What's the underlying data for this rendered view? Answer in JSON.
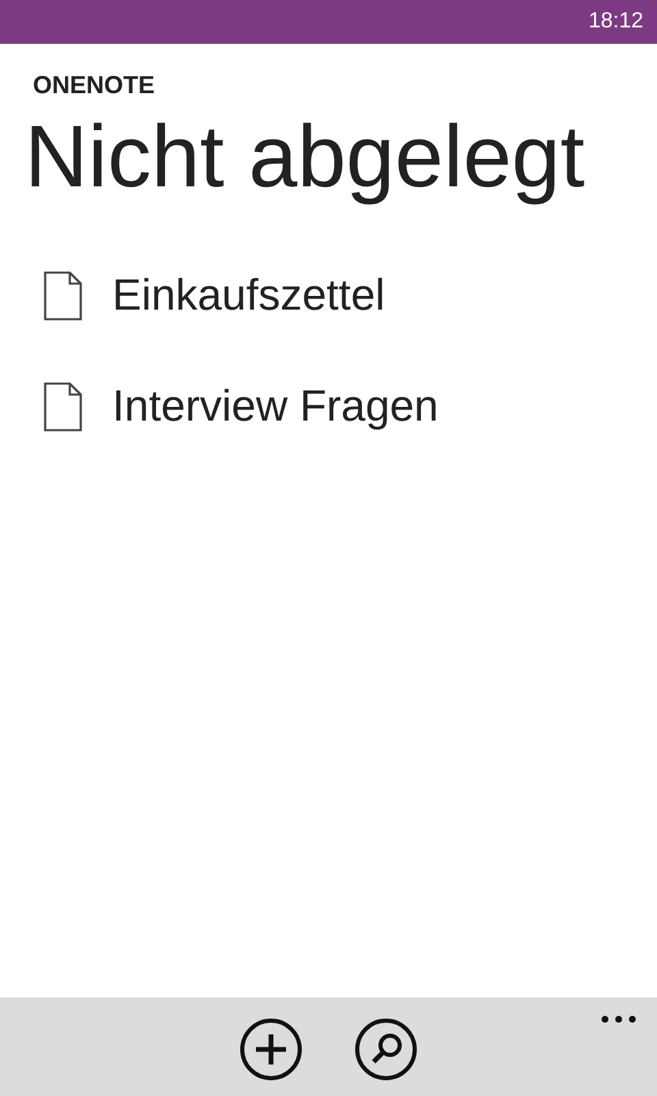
{
  "status_bar": {
    "time": "18:12"
  },
  "app": {
    "name": "ONENOTE",
    "title": "Nicht abgelegt"
  },
  "pages": [
    {
      "title": "Einkaufszettel"
    },
    {
      "title": "Interview Fragen"
    }
  ]
}
